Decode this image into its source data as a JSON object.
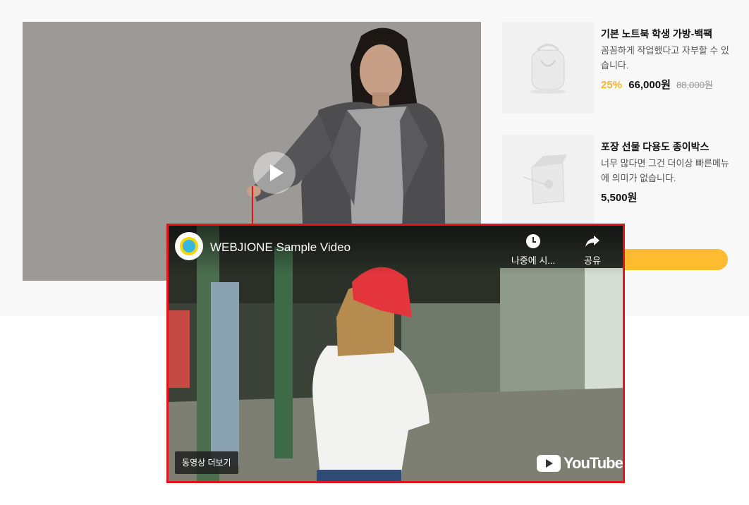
{
  "products": [
    {
      "name": "기본 노트북 학생 가방-백팩",
      "description": "꼼꼼하게 작업했다고 자부할 수 있습니다.",
      "discount": "25%",
      "price": "66,000원",
      "original_price": "88,000원"
    },
    {
      "name": "포장 선물 다용도 종이박스",
      "description": "너무 많다면 그건 더이상 빠른메뉴에 의미가 없습니다.",
      "price": "5,500원"
    }
  ],
  "video": {
    "title": "WEBJIONE Sample Video",
    "watch_later_label": "나중에 시...",
    "share_label": "공유",
    "more_videos_label": "동영상 더보기",
    "logo_text": "YouTube"
  },
  "colors": {
    "accent": "#fdbb2f",
    "discount": "#f7b52c",
    "highlight_border": "#e5131d"
  }
}
